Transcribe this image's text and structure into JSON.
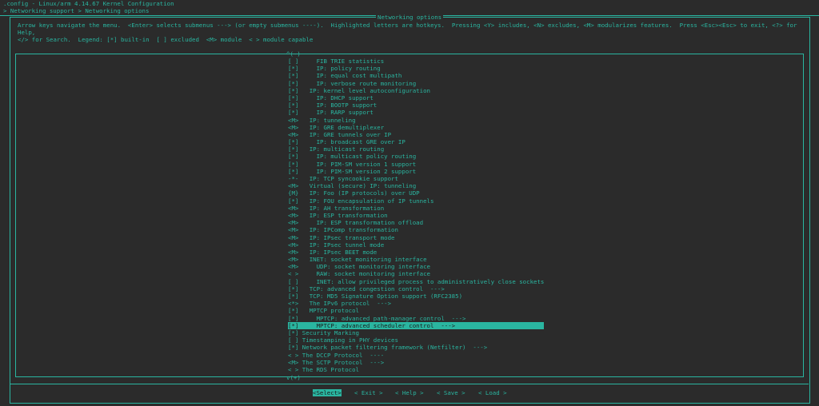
{
  "window_title": ".config - Linux/arm 4.14.67 Kernel Configuration",
  "breadcrumb": "> Networking support > Networking options",
  "dialog_title": "Networking options",
  "help_text": "Arrow keys navigate the menu.  <Enter> selects submenus ---> (or empty submenus ----).  Highlighted letters are hotkeys.  Pressing <Y> includes, <N> excludes, <M> modularizes features.  Press <Esc><Esc> to exit, <?> for Help,\n</> for Search.  Legend: [*] built-in  [ ] excluded  <M> module  < > module capable",
  "scroll_up": "^(-)",
  "scroll_down": "v(+)",
  "menu_items": [
    "[ ]     FIB TRIE statistics",
    "[*]     IP: policy routing",
    "[*]     IP: equal cost multipath",
    "[*]     IP: verbose route monitoring",
    "[*]   IP: kernel level autoconfiguration",
    "[*]     IP: DHCP support",
    "[*]     IP: BOOTP support",
    "[*]     IP: RARP support",
    "<M>   IP: tunneling",
    "<M>   IP: GRE demultiplexer",
    "<M>   IP: GRE tunnels over IP",
    "[*]     IP: broadcast GRE over IP",
    "[*]   IP: multicast routing",
    "[*]     IP: multicast policy routing",
    "[*]     IP: PIM-SM version 1 support",
    "[*]     IP: PIM-SM version 2 support",
    "-*-   IP: TCP syncookie support",
    "<M>   Virtual (secure) IP: tunneling",
    "{M}   IP: Foo (IP protocols) over UDP",
    "[*]   IP: FOU encapsulation of IP tunnels",
    "<M>   IP: AH transformation",
    "<M>   IP: ESP transformation",
    "<M>     IP: ESP transformation offload",
    "<M>   IP: IPComp transformation",
    "<M>   IP: IPsec transport mode",
    "<M>   IP: IPsec tunnel mode",
    "<M>   IP: IPsec BEET mode",
    "<M>   INET: socket monitoring interface",
    "<M>     UDP: socket monitoring interface",
    "< >     RAW: socket monitoring interface",
    "[ ]     INET: allow privileged process to administratively close sockets",
    "[*]   TCP: advanced congestion control  --->",
    "[*]   TCP: MD5 Signature Option support (RFC2385)",
    "<*>   The IPv6 protocol  --->",
    "[*]   MPTCP protocol",
    "[*]     MPTCP: advanced path-manager control  --->",
    "[*]     MPTCP: advanced scheduler control  --->",
    "[*] Security Marking",
    "[ ] Timestamping in PHY devices",
    "[*] Network packet filtering framework (Netfilter)  --->",
    "< > The DCCP Protocol  ----",
    "<M> The SCTP Protocol  --->",
    "< > The RDS Protocol"
  ],
  "selected_index": 36,
  "buttons": [
    "<Select>",
    "< Exit >",
    "< Help >",
    "< Save >",
    "< Load >"
  ],
  "active_button": 0,
  "colors": {
    "background": "#2b2b2b",
    "foreground": "#2ab5a0",
    "highlight": "#2ab5a0"
  }
}
